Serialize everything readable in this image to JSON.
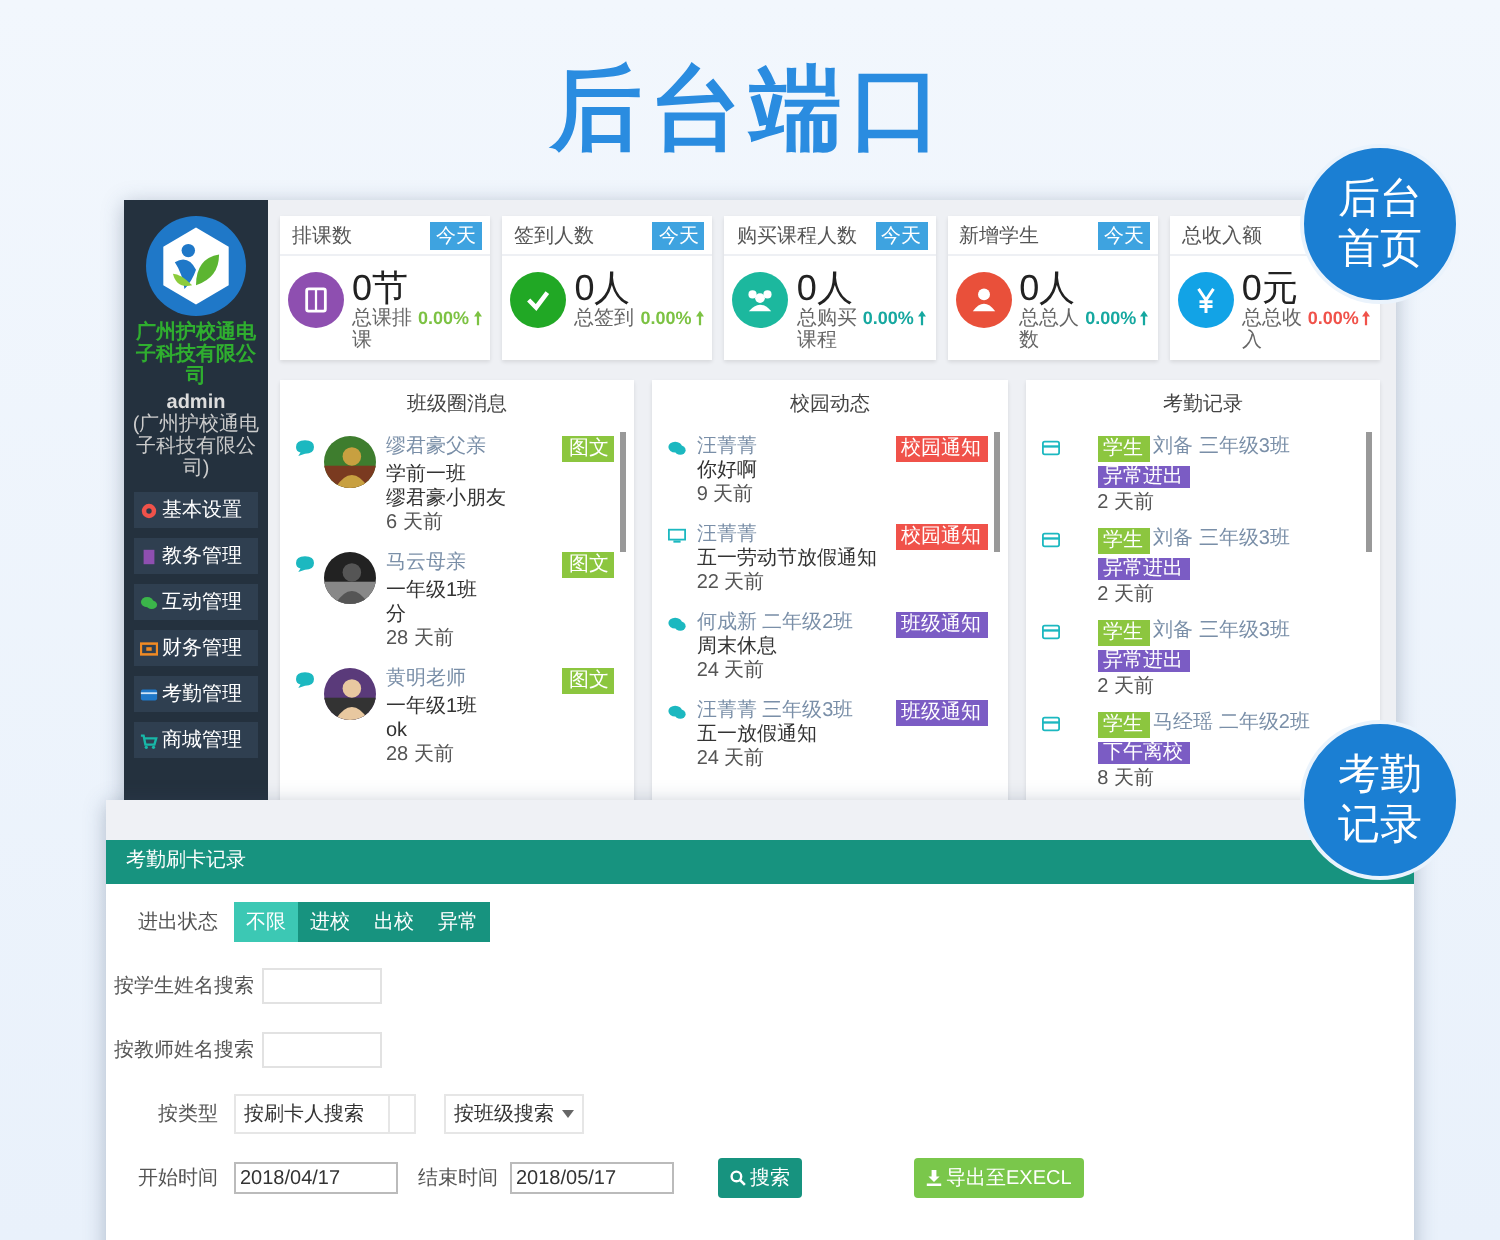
{
  "header": {
    "title": "后台端口"
  },
  "badges": [
    {
      "lines": [
        "后台",
        "首页"
      ]
    },
    {
      "lines": [
        "考勤",
        "记录"
      ]
    }
  ],
  "dashboard": {
    "sidebar": {
      "company": "广州护校通电子科技有限公司",
      "user": "admin",
      "org": "(广州护校通电子科技有限公司)",
      "menu": [
        {
          "label": "基本设置",
          "kind": "settings"
        },
        {
          "label": "教务管理",
          "kind": "academic"
        },
        {
          "label": "互动管理",
          "kind": "chat"
        },
        {
          "label": "财务管理",
          "kind": "finance"
        },
        {
          "label": "考勤管理",
          "kind": "attendance"
        },
        {
          "label": "商城管理",
          "kind": "shop"
        }
      ]
    },
    "stats": [
      {
        "label": "排课数",
        "badge": "今天",
        "kind": "lessons",
        "color": "#8e4fb0",
        "value": "0节",
        "caption": "总课排课",
        "change": "0.00%"
      },
      {
        "label": "签到人数",
        "badge": "今天",
        "kind": "checkin",
        "color": "#21a825",
        "value": "0人",
        "caption": "总签到",
        "change": "0.00%"
      },
      {
        "label": "购买课程人数",
        "badge": "今天",
        "kind": "buyers",
        "color": "#1cb89e",
        "value": "0人",
        "caption": "总购买课程",
        "change": "0.00%"
      },
      {
        "label": "新增学生",
        "badge": "今天",
        "kind": "students",
        "color": "#e9503a",
        "value": "0人",
        "caption": "总总人数",
        "change": "0.00%"
      },
      {
        "label": "总收入额",
        "kind": "income",
        "color": "#12a3e6",
        "value": "0元",
        "caption": "总总收入",
        "change": "0.00%"
      }
    ],
    "class_feed": {
      "title": "班级圈消息",
      "items": [
        {
          "author": "缪君豪父亲",
          "group": "学前一班",
          "text": "缪君豪小朋友",
          "time": "6 天前",
          "tag": "图文"
        },
        {
          "author": "马云母亲",
          "group": "一年级1班",
          "text": "分",
          "time": "28 天前",
          "tag": "图文"
        },
        {
          "author": "黄明老师",
          "group": "一年级1班",
          "text": "ok",
          "time": "28 天前",
          "tag": "图文"
        }
      ]
    },
    "campus_news": {
      "title": "校园动态",
      "items": [
        {
          "kind": "chat",
          "author": "汪菁菁",
          "text": "你好啊",
          "time": "9 天前",
          "tag": "校园通知",
          "color": "#f0524a"
        },
        {
          "kind": "screen",
          "author": "汪菁菁",
          "text": "五一劳动节放假通知",
          "time": "22 天前",
          "tag": "校园通知",
          "color": "#f0524a"
        },
        {
          "kind": "chat",
          "author": "何成新 二年级2班",
          "text": "周末休息",
          "time": "24 天前",
          "tag": "班级通知",
          "color": "#7b5cc4"
        },
        {
          "kind": "chat",
          "author": "汪菁菁 三年级3班",
          "text": "五一放假通知",
          "time": "24 天前",
          "tag": "班级通知",
          "color": "#7b5cc4"
        }
      ]
    },
    "attendance": {
      "title": "考勤记录",
      "items": [
        {
          "role": "学生",
          "name": "刘备 三年级3班",
          "status": "异常进出",
          "time": "2 天前"
        },
        {
          "role": "学生",
          "name": "刘备 三年级3班",
          "status": "异常进出",
          "time": "2 天前"
        },
        {
          "role": "学生",
          "name": "刘备 三年级3班",
          "status": "异常进出",
          "time": "2 天前"
        },
        {
          "role": "学生",
          "name": "马经瑶 二年级2班",
          "status": "下午离校",
          "time": "8 天前"
        }
      ]
    }
  },
  "form": {
    "title": "考勤刷卡记录",
    "status_filter": {
      "label": "进出状态",
      "options": [
        {
          "label": "不限",
          "selected": true
        },
        {
          "label": "进校",
          "selected": false
        },
        {
          "label": "出校",
          "selected": false
        },
        {
          "label": "异常",
          "selected": false
        }
      ]
    },
    "student_search": {
      "label": "按学生姓名搜索"
    },
    "teacher_search": {
      "label": "按教师姓名搜索"
    },
    "type": {
      "label": "按类型",
      "options": [
        "按刷卡人搜索",
        "按班级搜索"
      ]
    },
    "start": {
      "label": "开始时间",
      "value": "2018/04/17"
    },
    "end": {
      "label": "结束时间",
      "value": "2018/05/17"
    },
    "search_button": "搜索",
    "export_button": "导出至EXECL"
  }
}
